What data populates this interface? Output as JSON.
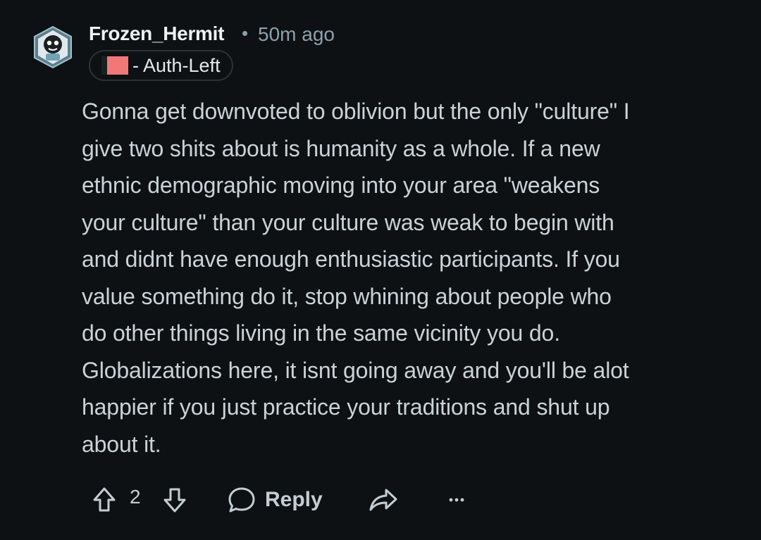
{
  "comment": {
    "author": "Frozen_Hermit",
    "separator": "•",
    "timestamp": "50m ago",
    "flair": {
      "text": "- Auth-Left",
      "swatch_color": "#f27878"
    },
    "body_lines": [
      "Gonna get downvoted to oblivion but the only \"culture\" I",
      "give two shits about is humanity as a whole. If a new",
      "ethnic demographic moving into your area \"weakens",
      "your culture\" than your culture was weak to begin with",
      "and didnt have enough enthusiastic participants. If you",
      "value something do it, stop whining about people who",
      "do other things living in the same vicinity you do.",
      "Globalizations here, it isnt going away and you'll be alot",
      "happier if you just practice your traditions and shut up",
      "about it."
    ]
  },
  "actions": {
    "upvote_icon": "arrow-up-outline-icon",
    "score": "2",
    "downvote_icon": "arrow-down-outline-icon",
    "reply_icon": "speech-bubble-icon",
    "reply_label": "Reply",
    "share_icon": "share-arrow-icon",
    "more_icon": "ellipsis-icon"
  },
  "colors": {
    "background": "#0e1113",
    "text": "#c9d3d8",
    "meta": "#8ba2ad",
    "flair_swatch": "#f27878"
  }
}
